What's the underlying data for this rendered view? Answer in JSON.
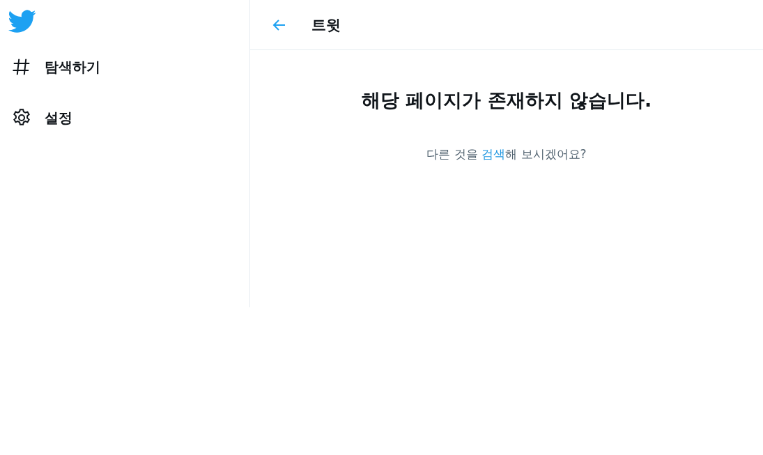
{
  "sidebar": {
    "items": [
      {
        "label": "탐색하기"
      },
      {
        "label": "설정"
      }
    ]
  },
  "header": {
    "title": "트윗"
  },
  "message": {
    "heading": "해당 페이지가 존재하지 않습니다.",
    "before": "다른 것을 ",
    "link": "검색",
    "after": "해 보시겠어요?"
  }
}
